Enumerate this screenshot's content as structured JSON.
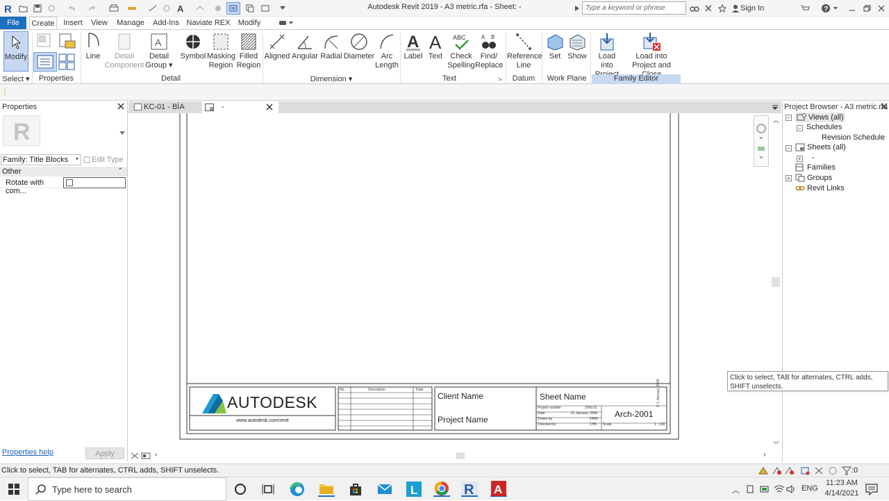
{
  "window": {
    "title": "Autodesk Revit 2019 - A3 metric.rfa - Sheet: -",
    "search_placeholder": "Type a keyword or phrase",
    "sign_in": "Sign In"
  },
  "menu": {
    "tabs": [
      "File",
      "Create",
      "Insert",
      "View",
      "Manage",
      "Add-Ins",
      "Naviate REX",
      "Modify"
    ],
    "active": "Create"
  },
  "ribbon": {
    "buttons": {
      "modify": "Modify",
      "line": "Line",
      "detail_component_1": "Detail",
      "detail_component_2": "Component",
      "detail_group_1": "Detail",
      "detail_group_2": "Group",
      "symbol": "Symbol",
      "masking_1": "Masking",
      "masking_2": "Region",
      "filled_1": "Filled",
      "filled_2": "Region",
      "aligned": "Aligned",
      "angular": "Angular",
      "radial": "Radial",
      "diameter": "Diameter",
      "arc_1": "Arc",
      "arc_2": "Length",
      "label": "Label",
      "text": "Text",
      "check_1": "Check",
      "check_2": "Spelling",
      "find_1": "Find/",
      "find_2": "Replace",
      "ref_1": "Reference",
      "ref_2": "Line",
      "set": "Set",
      "show": "Show",
      "load_1": "Load into",
      "load_2": "Project",
      "loadclose_1": "Load into",
      "loadclose_2": "Project and Close"
    },
    "panels": {
      "select": "Select",
      "properties": "Properties",
      "detail": "Detail",
      "dimension": "Dimension",
      "text": "Text",
      "datum": "Datum",
      "work_plane": "Work Plane",
      "family_editor": "Family Editor"
    }
  },
  "properties": {
    "title": "Properties",
    "type_selector": "Family: Title Blocks",
    "edit_type": "Edit Type",
    "group": "Other",
    "param_label": "Rotate with com...",
    "help": "Properties help",
    "apply": "Apply"
  },
  "view_tabs": [
    "KC-01 - BÌA",
    "-"
  ],
  "titleblock": {
    "logo_text": "AUTODESK",
    "website": "www.autodesk.com/revit",
    "rev_headers": [
      "No.",
      "Description",
      "Date"
    ],
    "client": "Client Name",
    "project": "Project Name",
    "sheet_name": "Sheet Name",
    "sheet_number": "Arch-2001",
    "project_number_label": "Project number",
    "project_number_value": "2000.01",
    "date_label": "Date",
    "date_value": "01 January, 2000",
    "drawn_label": "Drawn by",
    "drawn_value": "DRW",
    "checked_label": "Checked by",
    "checked_value": "CHK",
    "scale_label": "Scale",
    "scale_value": "1 : 100",
    "side_text": "© 1 January, 2000"
  },
  "project_browser": {
    "title": "Project Browser - A3 metric.rfa",
    "items": {
      "views": "Views (all)",
      "schedules": "Schedules",
      "revision_schedule": "Revision Schedule",
      "sheets": "Sheets (all)",
      "sheet_dash": "-",
      "families": "Families",
      "groups": "Groups",
      "revit_links": "Revit Links"
    }
  },
  "tooltip": "Click to select, TAB for alternates, CTRL adds, SHIFT unselects.",
  "status": {
    "text": "Click to select, TAB for alternates, CTRL adds, SHIFT unselects.",
    "filter_count": ":0"
  },
  "taskbar": {
    "search_placeholder": "Type here to search",
    "language": "ENG",
    "time": "11:23 AM",
    "date": "4/14/2021"
  },
  "colors": {
    "accent": "#1e6fbf",
    "family_editor_bg": "#c8d8f0",
    "revit_blue": "#2a5aa8"
  }
}
